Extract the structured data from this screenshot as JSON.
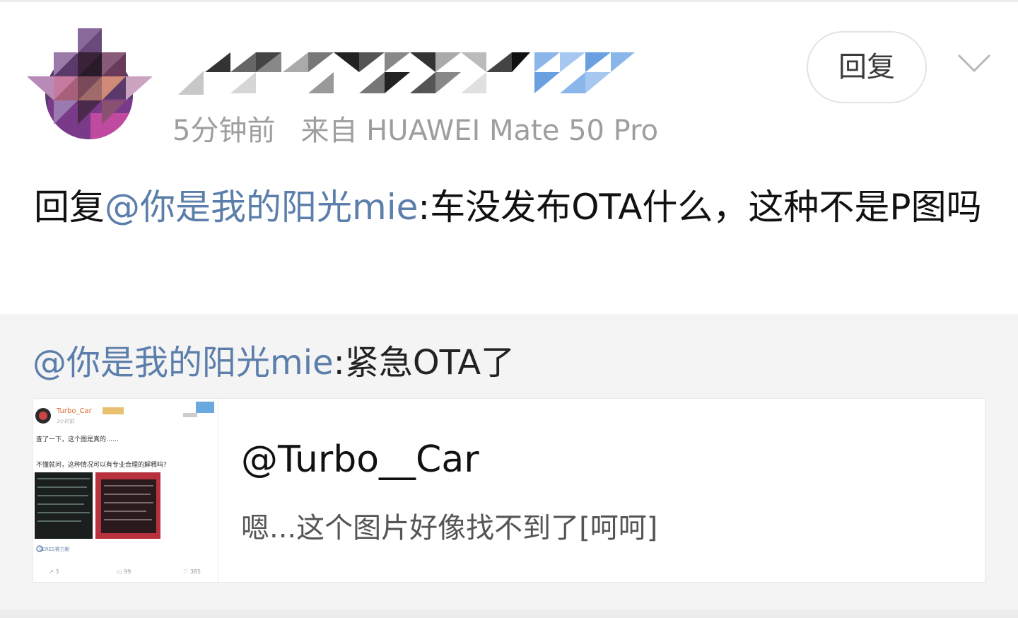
{
  "post": {
    "time": "5分钟前",
    "source": "来自 HUAWEI Mate 50 Pro",
    "reply_button": "回复",
    "comment": {
      "prefix": "回复",
      "mention": "@你是我的阳光mie",
      "text": ":车没发布OTA什么，这种不是P图吗"
    }
  },
  "quote": {
    "mention": "@你是我的阳光mie",
    "text": ":紧急OTA了",
    "card": {
      "title": "@Turbo__Car",
      "description": "嗯...这个图片好像找不到了[呵呵]",
      "thumbnail": {
        "name": "Turbo_Car",
        "time": "3小时前",
        "line1": "查了一下，这个图是真的……",
        "line2": "不懂就问，这种情况可以有专业合理的解释吗?",
        "tag": "SERES赛力斯",
        "repost": "3",
        "comments": "99",
        "likes": "385"
      }
    }
  },
  "colors": {
    "link": "#5b7eaa",
    "meta": "#9e9e9e",
    "quote_bg": "#f4f4f4"
  }
}
